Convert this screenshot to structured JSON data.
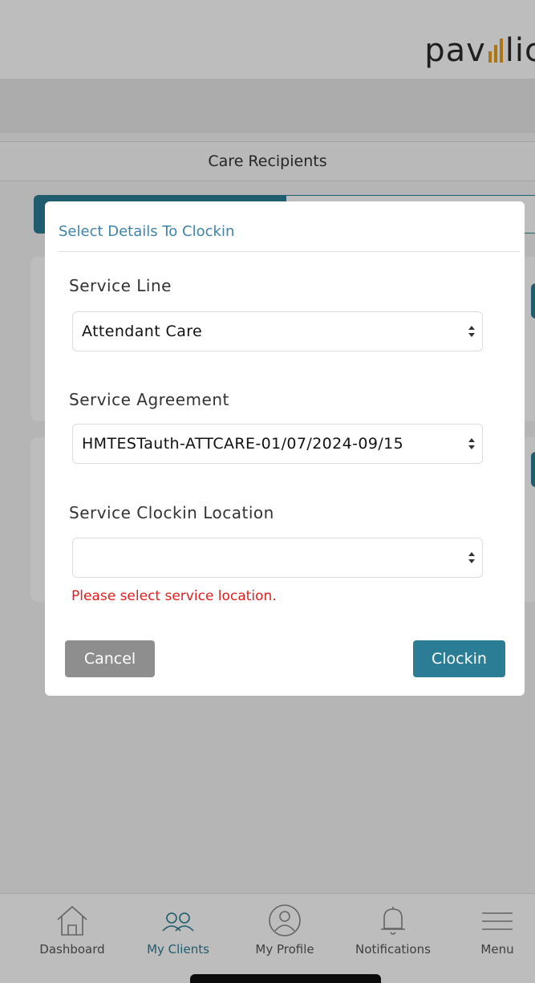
{
  "header": {
    "logo_text_start": "pav",
    "logo_text_end": "lic"
  },
  "page": {
    "title": "Care Recipients"
  },
  "modal": {
    "title": "Select Details To Clockin",
    "service_line": {
      "label": "Service Line",
      "value": "Attendant Care"
    },
    "service_agreement": {
      "label": "Service Agreement",
      "value": "HMTESTauth-ATTCARE-01/07/2024-09/15"
    },
    "service_location": {
      "label": "Service Clockin Location",
      "value": ""
    },
    "error": "Please select service location.",
    "cancel_label": "Cancel",
    "clockin_label": "Clockin"
  },
  "nav": {
    "items": [
      {
        "label": "Dashboard",
        "icon": "home-icon"
      },
      {
        "label": "My Clients",
        "icon": "clients-icon",
        "active": true
      },
      {
        "label": "My Profile",
        "icon": "profile-icon"
      },
      {
        "label": "Notifications",
        "icon": "bell-icon"
      },
      {
        "label": "Menu",
        "icon": "menu-icon"
      }
    ]
  },
  "colors": {
    "accent": "#2a7d94",
    "error": "#e02020",
    "logo_bars": "#e8a020",
    "cancel": "#8e8e8e"
  }
}
